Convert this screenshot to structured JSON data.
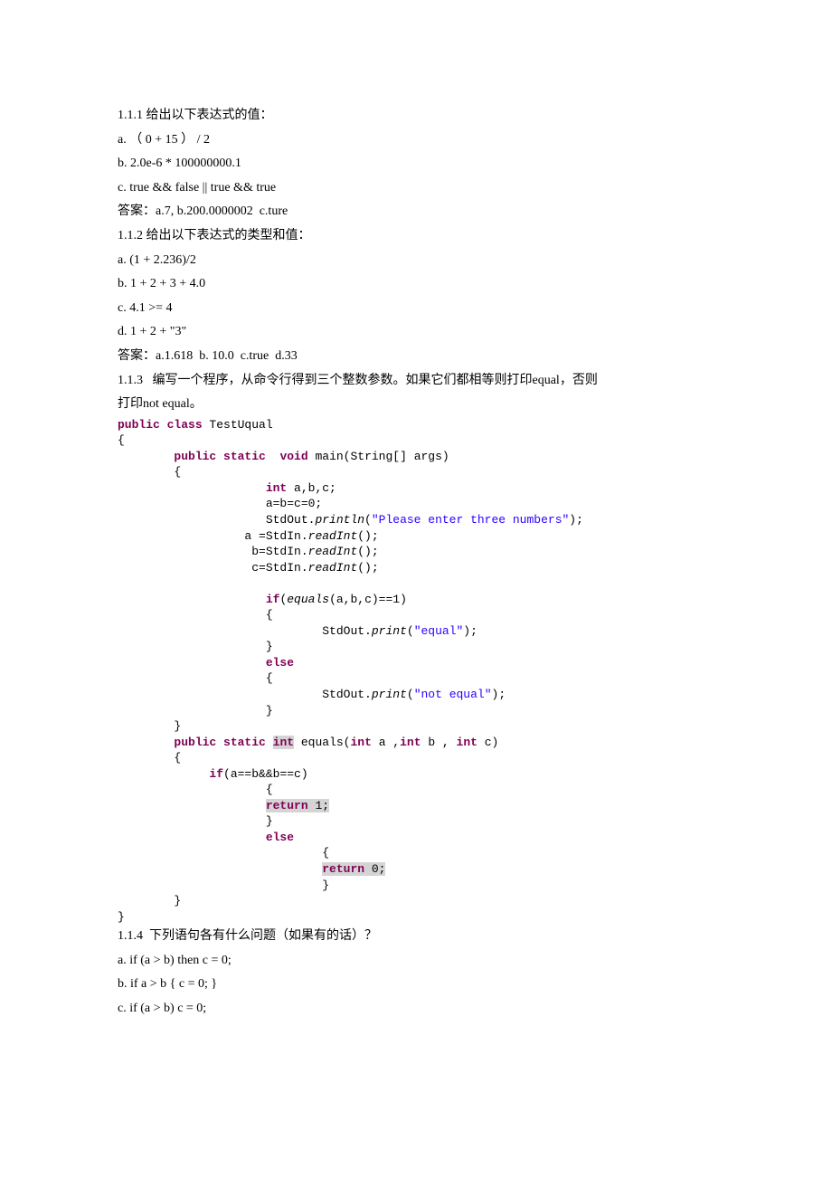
{
  "q1": {
    "title": "1.1.1 给出以下表达式的值：",
    "a": "a. （ 0 + 15 ） / 2",
    "b": "b. 2.0e-6 * 100000000.1",
    "c": "c. true && false || true && true",
    "ans": "答案：a.7, b.200.0000002  c.ture"
  },
  "q2": {
    "title": "1.1.2 给出以下表达式的类型和值：",
    "a": "a. (1 + 2.236)/2",
    "b": "b. 1 + 2 + 3 + 4.0",
    "c": "c. 4.1 >= 4",
    "d": "d. 1 + 2 + \"3\"",
    "ans": "答案：a.1.618  b. 10.0  c.true  d.33"
  },
  "q3": {
    "title1": "1.1.3   编写一个程序，从命令行得到三个整数参数。如果它们都相等则打印equal，否则",
    "title2": "打印not equal。"
  },
  "code": {
    "kw_publicclass": "public class",
    "cls": " TestUqual",
    "lb": "{",
    "rb": "}",
    "kw_publicstatic": "public static",
    "kw_void": "void",
    "main_sig": " main(String[] args)",
    "indent2": "        ",
    "indent2lb": "        {",
    "indent2rb": "        }",
    "kw_int": "int",
    "decl": " a,b,c;",
    "init": "                     a=b=c=0;",
    "printlnPrefix": "                     StdOut.",
    "println": "println",
    "str1": "\"Please enter three numbers\"",
    "readA": "                  a =StdIn.",
    "readInt": "readInt",
    "unit": "();",
    "readB": "                   b=StdIn.",
    "readC": "                   c=StdIn.",
    "kw_if": "if",
    "ifCond": "(",
    "equalsCall": "equals",
    "equalsArgs": "(a,b,c)==1)",
    "ifLine": "                     ",
    "lb3": "                     {",
    "rb3": "                     }",
    "printPrefix": "                             StdOut.",
    "print": "print",
    "strEqual": "\"equal\"",
    "kw_else": "else",
    "elseLine": "                     ",
    "strNotEqual": "\"not equal\"",
    "kw_int2": "int",
    "equalsSig1": " equals(",
    "equalsSig2": " a ,",
    "equalsSig3": " b , ",
    "equalsSig4": " c)",
    "ifCond2": "(a==b&&b==c)",
    "ret1": "return",
    "ret1v": " 1;",
    "ret0": "return",
    "ret0v": " 0;",
    "indent3": "             "
  },
  "q4": {
    "title": "1.1.4  下列语句各有什么问题（如果有的话）？",
    "a": "a. if (a > b) then c = 0;",
    "b": "b. if a > b { c = 0; }",
    "c": "c. if (a > b) c = 0;"
  }
}
